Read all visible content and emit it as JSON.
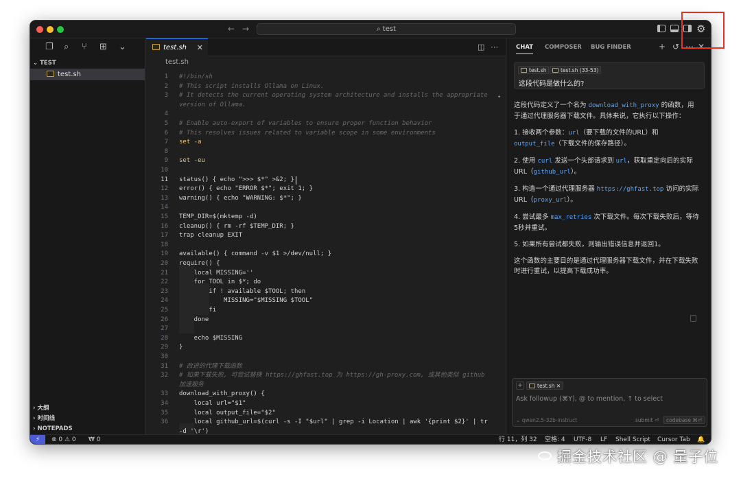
{
  "titlebar": {
    "search": "test"
  },
  "sidebar": {
    "section_title": "TEST",
    "file": "test.sh",
    "bottom_sections": [
      "大纲",
      "时间线",
      "NOTEPADS"
    ]
  },
  "editor": {
    "tab": "test.sh",
    "breadcrumb": "test.sh",
    "active_line": 11,
    "lines": [
      {
        "n": "1",
        "t": "#!/bin/sh",
        "c": true
      },
      {
        "n": "2",
        "t": "# This script installs Ollama on Linux.",
        "c": true
      },
      {
        "n": "3",
        "t": "# It detects the current operating system architecture and installs the appropriate",
        "c": true
      },
      {
        "n": "",
        "t": "version of Ollama.",
        "c": true
      },
      {
        "n": "4",
        "t": ""
      },
      {
        "n": "5",
        "t": "# Enable auto-export of variables to ensure proper function behavior",
        "c": true
      },
      {
        "n": "6",
        "t": "# This resolves issues related to variable scope in some environments",
        "c": true
      },
      {
        "n": "7",
        "t": "set -a",
        "kw": true
      },
      {
        "n": "8",
        "t": ""
      },
      {
        "n": "9",
        "t": "set -eu",
        "kw": true
      },
      {
        "n": "10",
        "t": ""
      },
      {
        "n": "11",
        "t": "status() { echo \">>> $*\" >&2; }"
      },
      {
        "n": "12",
        "t": "error() { echo \"ERROR $*\"; exit 1; }"
      },
      {
        "n": "13",
        "t": "warning() { echo \"WARNING: $*\"; }"
      },
      {
        "n": "14",
        "t": ""
      },
      {
        "n": "15",
        "t": "TEMP_DIR=$(mktemp -d)"
      },
      {
        "n": "16",
        "t": "cleanup() { rm -rf $TEMP_DIR; }"
      },
      {
        "n": "17",
        "t": "trap cleanup EXIT"
      },
      {
        "n": "18",
        "t": ""
      },
      {
        "n": "19",
        "t": "available() { command -v $1 >/dev/null; }"
      },
      {
        "n": "20",
        "t": "require() {"
      },
      {
        "n": "21",
        "t": "    local MISSING=''"
      },
      {
        "n": "22",
        "t": "    for TOOL in $*; do"
      },
      {
        "n": "23",
        "t": "        if ! available $TOOL; then"
      },
      {
        "n": "24",
        "t": "            MISSING=\"$MISSING $TOOL\""
      },
      {
        "n": "25",
        "t": "        fi"
      },
      {
        "n": "26",
        "t": "    done"
      },
      {
        "n": "27",
        "t": ""
      },
      {
        "n": "28",
        "t": "    echo $MISSING"
      },
      {
        "n": "29",
        "t": "}"
      },
      {
        "n": "30",
        "t": ""
      },
      {
        "n": "31",
        "t": "# 改进的代理下载函数",
        "c": true
      },
      {
        "n": "32",
        "t": "# 如果下载失败, 可尝试替换 https://ghfast.top 为 https://gh-proxy.com, 或其他类似 github",
        "c": true
      },
      {
        "n": "",
        "t": "加速服务",
        "c": true
      },
      {
        "n": "33",
        "t": "download_with_proxy() {"
      },
      {
        "n": "34",
        "t": "    local url=\"$1\""
      },
      {
        "n": "35",
        "t": "    local output_file=\"$2\""
      },
      {
        "n": "36",
        "t": "    local github_url=$(curl -s -I \"$url\" | grep -i Location | awk '{print $2}' | tr"
      },
      {
        "n": "",
        "t": "-d '\\r')"
      }
    ]
  },
  "chat": {
    "tabs": [
      "CHAT",
      "COMPOSER",
      "BUG FINDER"
    ],
    "context_chips": [
      "test.sh",
      "test.sh (33-53)"
    ],
    "question": "这段代码是做什么的?",
    "answer": {
      "intro_a": "这段代码定义了一个名为 ",
      "intro_code": "download_with_proxy",
      "intro_b": " 的函数，用于通过代理服务器下载文件。具体来说，它执行以下操作：",
      "s1_a": "1. 接收两个参数：",
      "s1_c1": "url",
      "s1_b": "（要下载的文件的URL）和 ",
      "s1_c2": "output_file",
      "s1_c": "（下载文件的保存路径）。",
      "s2_a": "2. 使用 ",
      "s2_c1": "curl",
      "s2_b": " 发送一个头部请求到 ",
      "s2_c2": "url",
      "s2_c": "，获取重定向后的实际URL（",
      "s2_c3": "github_url",
      "s2_d": "）。",
      "s3_a": "3. 构造一个通过代理服务器 ",
      "s3_c1": "https://ghfast.top",
      "s3_b": " 访问的实际URL（",
      "s3_c2": "proxy_url",
      "s3_c": "）。",
      "s4_a": "4. 尝试最多 ",
      "s4_c1": "max_retries",
      "s4_b": " 次下载文件。每次下载失败后，等待5秒并重试。",
      "s5": "5. 如果所有尝试都失败，则输出错误信息并返回1。",
      "summary": "这个函数的主要目的是通过代理服务器下载文件，并在下载失败时进行重试，以提高下载成功率。"
    },
    "input": {
      "chip": "test.sh",
      "placeholder": "Ask followup (⌘Y), @ to mention, ↑ to select",
      "model": "⌄ qwen2.5-32b-instruct",
      "submit": "submit ⏎",
      "codebase": "codebase ⌘⏎"
    }
  },
  "statusbar": {
    "problems": "⊗ 0 ⚠ 0",
    "ports": "₩ 0",
    "position": "行 11，列 32",
    "spaces": "空格: 4",
    "encoding": "UTF-8",
    "eol": "LF",
    "language": "Shell Script",
    "tab": "Cursor Tab",
    "bell": "🔔"
  },
  "watermark": "掘金技术社区 @ 量子位",
  "colors": {
    "accent": "#3b82f6",
    "code_link": "#58a6ff",
    "highlight": "#e5332a"
  }
}
